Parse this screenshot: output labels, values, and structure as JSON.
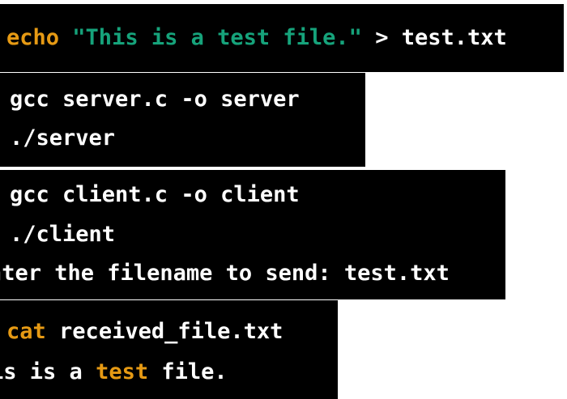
{
  "colors": {
    "background": "#000000",
    "text": "#ffffff",
    "command": "#e69a14",
    "string": "#16a37b",
    "highlight": "#e69a14",
    "divider": "#ffffff"
  },
  "blocks": [
    {
      "lines": [
        {
          "cmd": "echo",
          "string": "\"This is a test file.\"",
          "rest": "> test.txt"
        }
      ]
    },
    {
      "lines": [
        {
          "text": "gcc server.c -o server"
        },
        {
          "text": "./server"
        }
      ]
    },
    {
      "lines": [
        {
          "text": "gcc client.c -o client"
        },
        {
          "text": "./client"
        },
        {
          "text": "nter the filename to send: test.txt"
        }
      ]
    },
    {
      "lines": [
        {
          "cmd": "cat",
          "rest": "received_file.txt"
        },
        {
          "before": "is is a",
          "highlight": "test",
          "after": "file."
        }
      ]
    }
  ]
}
